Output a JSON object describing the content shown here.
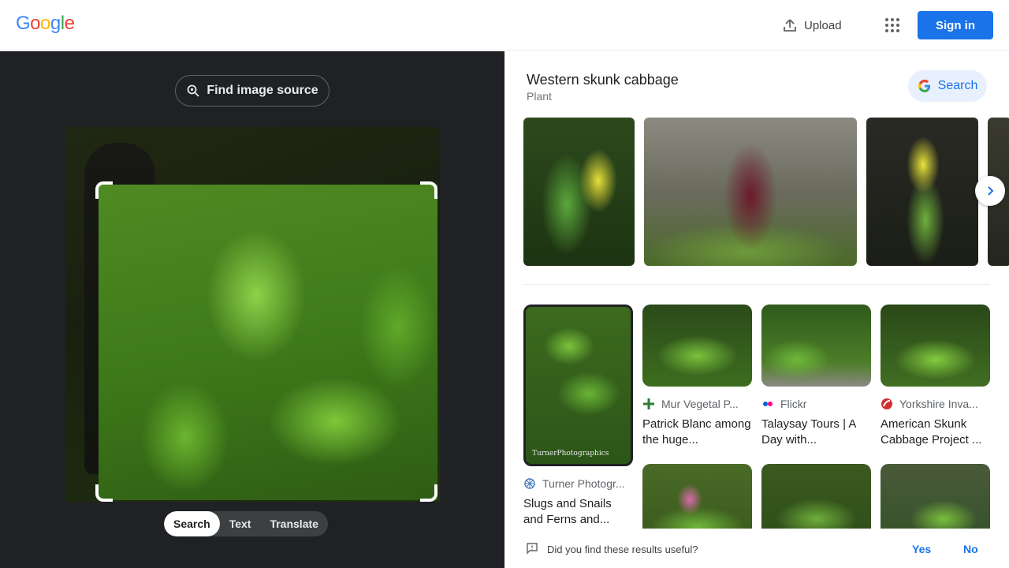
{
  "header": {
    "logo": [
      "G",
      "o",
      "o",
      "g",
      "l",
      "e"
    ],
    "logo_colors": [
      "#4285f4",
      "#ea4335",
      "#fbbc05",
      "#4285f4",
      "#34a853",
      "#ea4335"
    ],
    "upload_label": "Upload",
    "apps_icon": "apps-grid-icon",
    "signin_label": "Sign in"
  },
  "left_panel": {
    "find_source_label": "Find image source",
    "modes": [
      "Search",
      "Text",
      "Translate"
    ],
    "active_mode": "Search"
  },
  "entity": {
    "title": "Western skunk cabbage",
    "subtitle": "Plant",
    "search_label": "Search"
  },
  "results": [
    {
      "source": "Turner Photogr...",
      "title": "Slugs and Snails and Ferns and...",
      "icon": "turner-favicon"
    },
    {
      "source": "Mur Vegetal P...",
      "title": "Patrick Blanc among the huge...",
      "icon": "mur-vegetal-favicon"
    },
    {
      "source": "Flickr",
      "title": "Talaysay Tours | A Day with...",
      "icon": "flickr-favicon"
    },
    {
      "source": "Yorkshire Inva...",
      "title": "American Skunk Cabbage Project ...",
      "icon": "yorkshire-favicon"
    }
  ],
  "watermark": "TurnerPhotographics",
  "feedback": {
    "question": "Did you find these results useful?",
    "yes": "Yes",
    "no": "No"
  },
  "colors": {
    "accent": "#1a73e8",
    "dark_panel": "#202124"
  }
}
